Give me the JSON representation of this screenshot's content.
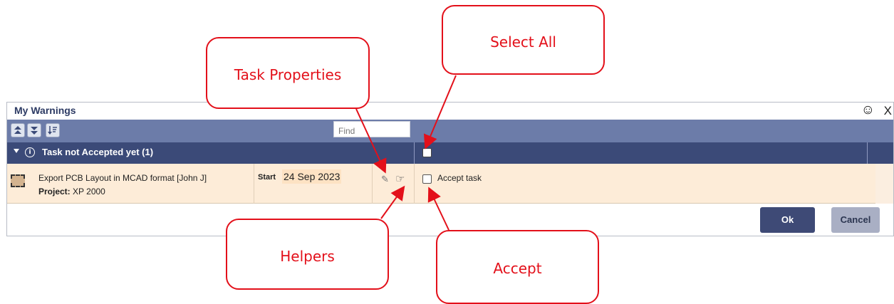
{
  "dialog": {
    "title": "My Warnings",
    "smiley_glyph": "☺",
    "close_label": "X",
    "toolbar": {
      "buttons": [
        "collapse-all-icon",
        "expand-all-icon",
        "sort-icon"
      ],
      "find_placeholder": "Find"
    },
    "group": {
      "label": "Task not Accepted yet (1)",
      "icon": "info-icon"
    },
    "task": {
      "name": "Export PCB Layout in MCAD format [John J]",
      "project_label": "Project:",
      "project_value": "XP 2000",
      "start_label": "Start",
      "start_date": "24 Sep 2023",
      "accept_label": "Accept task"
    },
    "ok_label": "Ok",
    "cancel_label": "Cancel"
  },
  "callouts": {
    "task_properties": "Task Properties",
    "select_all": "Select All",
    "helpers": "Helpers",
    "accept": "Accept"
  },
  "colors": {
    "toolbar": "#6c7ca9",
    "group_header": "#3b4a78",
    "row_bg": "#fdecd8",
    "callout_red": "#e3101a",
    "ok_button": "#3e4a76"
  }
}
